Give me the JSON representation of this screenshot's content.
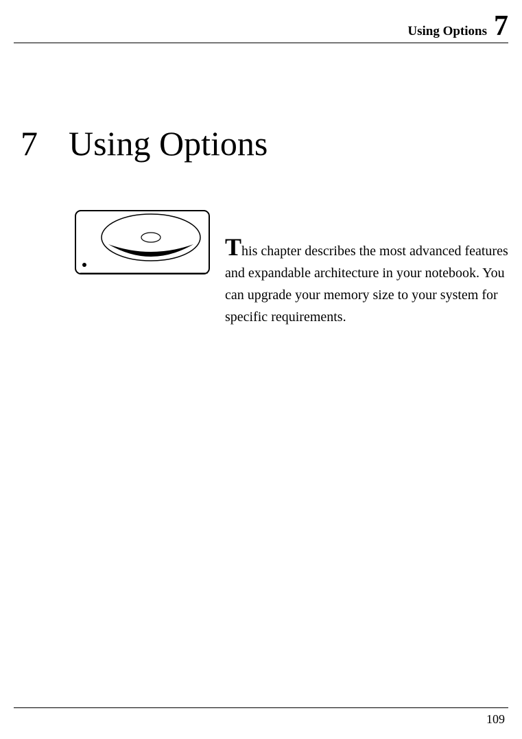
{
  "header": {
    "title": "Using Options",
    "chapter_number": "7"
  },
  "chapter": {
    "number": "7",
    "title": "Using Options"
  },
  "body": {
    "dropcap": "T",
    "text": "his chapter describes the most advanced features and expandable architecture in your notebook. You can upgrade your memory size to your system for specific requirements."
  },
  "footer": {
    "page_number": "109"
  }
}
